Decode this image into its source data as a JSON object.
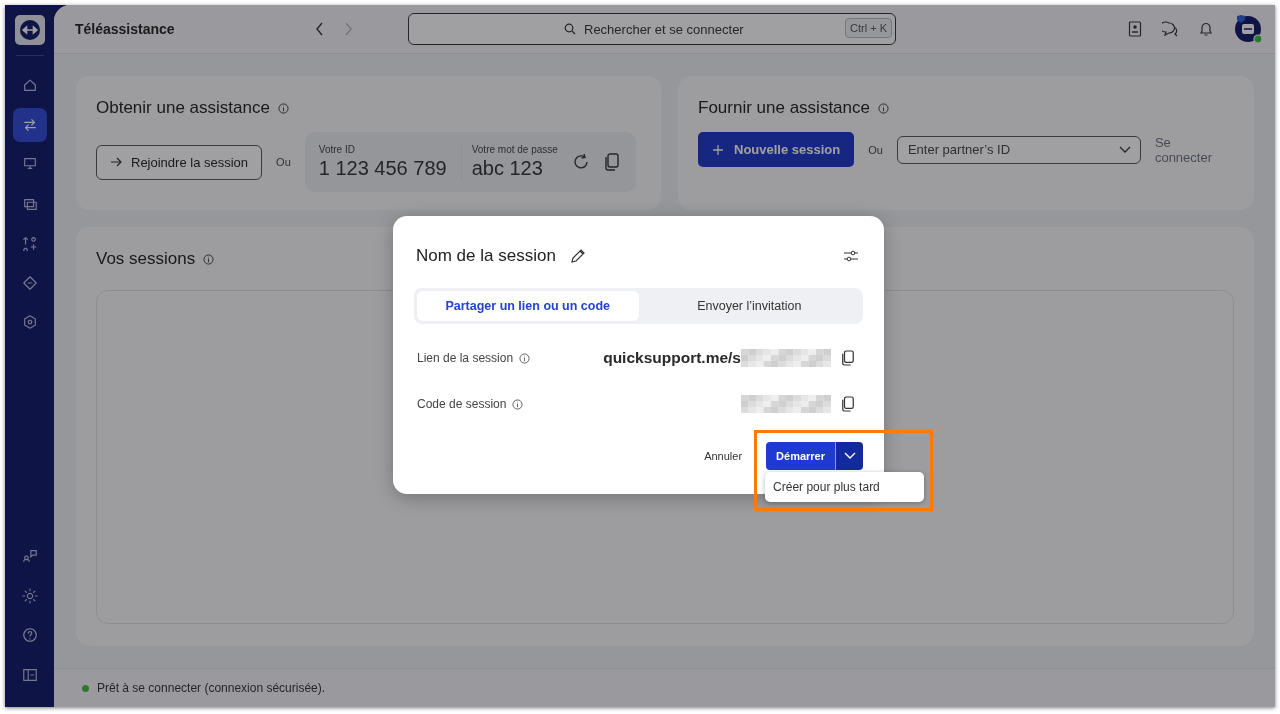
{
  "window": {
    "title": "Téléassistance"
  },
  "sidebar": {
    "items": [
      {
        "selected": false
      },
      {
        "selected": true
      },
      {
        "selected": false
      },
      {
        "selected": false
      },
      {
        "selected": false
      },
      {
        "selected": false
      },
      {
        "selected": false
      }
    ]
  },
  "nav_buttons": [
    {
      "disabled": false
    },
    {
      "disabled": true
    }
  ],
  "search": {
    "placeholder": "Rechercher et se connecter",
    "shortcut": "Ctrl + K"
  },
  "get_support": {
    "title": "Obtenir une assistance",
    "join_button": "Rejoindre la session",
    "or": "Ou",
    "id_label": "Votre ID",
    "id": "1 123 456 789",
    "password_label": "Votre mot de passe",
    "password": "abc 123"
  },
  "provide_support": {
    "title": "Fournir une assistance",
    "new_session_button": "Nouvelle session",
    "or": "Ou",
    "partner_id": {
      "placeholder": "Enter partner’s ID"
    },
    "connect_button": "Se connecter",
    "connect_disabled": true
  },
  "sessions": {
    "title": "Vos sessions"
  },
  "dialog": {
    "title": "Nom de la session",
    "tabs": [
      {
        "label": "Partager un lien ou un code",
        "selected": true
      },
      {
        "label": "Envoyer l’invitation",
        "selected": false
      }
    ],
    "rows": [
      {
        "label": "Lien de la session",
        "value": "quicksupport.me/s",
        "redacted": true
      },
      {
        "label": "Code de session",
        "redacted": true
      }
    ],
    "cancel_button": "Annuler",
    "start_button": "Démarrer",
    "start_highlighted": true,
    "menu": {
      "items": [
        "Créer pour plus tard"
      ]
    }
  },
  "status_bar": {
    "text": "Prêt à se connecter (connexion sécurisée)."
  }
}
